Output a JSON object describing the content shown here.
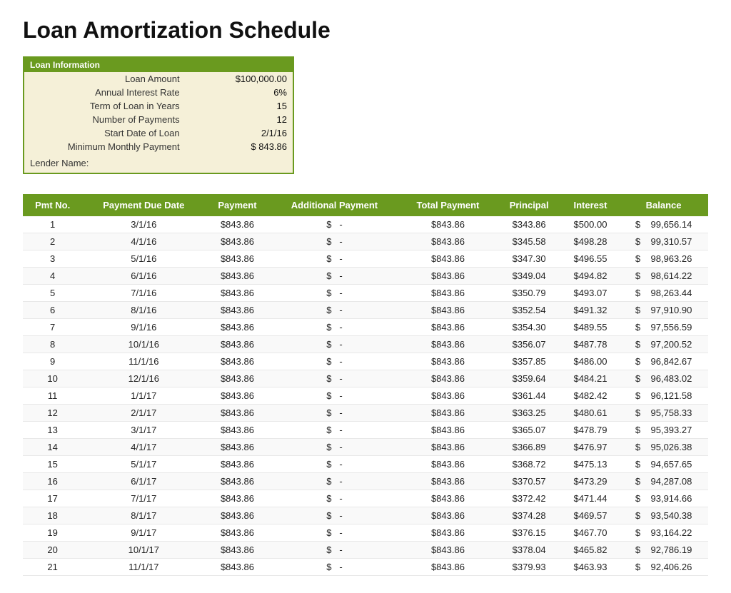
{
  "page": {
    "title": "Loan Amortization Schedule"
  },
  "loanInfo": {
    "sectionTitle": "Loan Information",
    "fields": [
      {
        "label": "Loan Amount",
        "value": "$100,000.00"
      },
      {
        "label": "Annual Interest Rate",
        "value": "6%"
      },
      {
        "label": "Term of Loan in Years",
        "value": "15"
      },
      {
        "label": "Number of Payments",
        "value": "12"
      },
      {
        "label": "Start Date of Loan",
        "value": "2/1/16"
      },
      {
        "label": "Minimum Monthly Payment",
        "value": "$     843.86"
      }
    ],
    "lenderLabel": "Lender Name:"
  },
  "table": {
    "columns": [
      "Pmt No.",
      "Payment Due Date",
      "Payment",
      "Additional Payment",
      "Total Payment",
      "Principal",
      "Interest",
      "Balance"
    ],
    "rows": [
      {
        "pmt": "1",
        "date": "3/1/16",
        "payment": "$843.86",
        "addl_dollar": "$",
        "addl": "-",
        "total": "$843.86",
        "principal": "$343.86",
        "interest": "$500.00",
        "bal_dollar": "$",
        "balance": "99,656.14"
      },
      {
        "pmt": "2",
        "date": "4/1/16",
        "payment": "$843.86",
        "addl_dollar": "$",
        "addl": "-",
        "total": "$843.86",
        "principal": "$345.58",
        "interest": "$498.28",
        "bal_dollar": "$",
        "balance": "99,310.57"
      },
      {
        "pmt": "3",
        "date": "5/1/16",
        "payment": "$843.86",
        "addl_dollar": "$",
        "addl": "-",
        "total": "$843.86",
        "principal": "$347.30",
        "interest": "$496.55",
        "bal_dollar": "$",
        "balance": "98,963.26"
      },
      {
        "pmt": "4",
        "date": "6/1/16",
        "payment": "$843.86",
        "addl_dollar": "$",
        "addl": "-",
        "total": "$843.86",
        "principal": "$349.04",
        "interest": "$494.82",
        "bal_dollar": "$",
        "balance": "98,614.22"
      },
      {
        "pmt": "5",
        "date": "7/1/16",
        "payment": "$843.86",
        "addl_dollar": "$",
        "addl": "-",
        "total": "$843.86",
        "principal": "$350.79",
        "interest": "$493.07",
        "bal_dollar": "$",
        "balance": "98,263.44"
      },
      {
        "pmt": "6",
        "date": "8/1/16",
        "payment": "$843.86",
        "addl_dollar": "$",
        "addl": "-",
        "total": "$843.86",
        "principal": "$352.54",
        "interest": "$491.32",
        "bal_dollar": "$",
        "balance": "97,910.90"
      },
      {
        "pmt": "7",
        "date": "9/1/16",
        "payment": "$843.86",
        "addl_dollar": "$",
        "addl": "-",
        "total": "$843.86",
        "principal": "$354.30",
        "interest": "$489.55",
        "bal_dollar": "$",
        "balance": "97,556.59"
      },
      {
        "pmt": "8",
        "date": "10/1/16",
        "payment": "$843.86",
        "addl_dollar": "$",
        "addl": "-",
        "total": "$843.86",
        "principal": "$356.07",
        "interest": "$487.78",
        "bal_dollar": "$",
        "balance": "97,200.52"
      },
      {
        "pmt": "9",
        "date": "11/1/16",
        "payment": "$843.86",
        "addl_dollar": "$",
        "addl": "-",
        "total": "$843.86",
        "principal": "$357.85",
        "interest": "$486.00",
        "bal_dollar": "$",
        "balance": "96,842.67"
      },
      {
        "pmt": "10",
        "date": "12/1/16",
        "payment": "$843.86",
        "addl_dollar": "$",
        "addl": "-",
        "total": "$843.86",
        "principal": "$359.64",
        "interest": "$484.21",
        "bal_dollar": "$",
        "balance": "96,483.02"
      },
      {
        "pmt": "11",
        "date": "1/1/17",
        "payment": "$843.86",
        "addl_dollar": "$",
        "addl": "-",
        "total": "$843.86",
        "principal": "$361.44",
        "interest": "$482.42",
        "bal_dollar": "$",
        "balance": "96,121.58"
      },
      {
        "pmt": "12",
        "date": "2/1/17",
        "payment": "$843.86",
        "addl_dollar": "$",
        "addl": "-",
        "total": "$843.86",
        "principal": "$363.25",
        "interest": "$480.61",
        "bal_dollar": "$",
        "balance": "95,758.33"
      },
      {
        "pmt": "13",
        "date": "3/1/17",
        "payment": "$843.86",
        "addl_dollar": "$",
        "addl": "-",
        "total": "$843.86",
        "principal": "$365.07",
        "interest": "$478.79",
        "bal_dollar": "$",
        "balance": "95,393.27"
      },
      {
        "pmt": "14",
        "date": "4/1/17",
        "payment": "$843.86",
        "addl_dollar": "$",
        "addl": "-",
        "total": "$843.86",
        "principal": "$366.89",
        "interest": "$476.97",
        "bal_dollar": "$",
        "balance": "95,026.38"
      },
      {
        "pmt": "15",
        "date": "5/1/17",
        "payment": "$843.86",
        "addl_dollar": "$",
        "addl": "-",
        "total": "$843.86",
        "principal": "$368.72",
        "interest": "$475.13",
        "bal_dollar": "$",
        "balance": "94,657.65"
      },
      {
        "pmt": "16",
        "date": "6/1/17",
        "payment": "$843.86",
        "addl_dollar": "$",
        "addl": "-",
        "total": "$843.86",
        "principal": "$370.57",
        "interest": "$473.29",
        "bal_dollar": "$",
        "balance": "94,287.08"
      },
      {
        "pmt": "17",
        "date": "7/1/17",
        "payment": "$843.86",
        "addl_dollar": "$",
        "addl": "-",
        "total": "$843.86",
        "principal": "$372.42",
        "interest": "$471.44",
        "bal_dollar": "$",
        "balance": "93,914.66"
      },
      {
        "pmt": "18",
        "date": "8/1/17",
        "payment": "$843.86",
        "addl_dollar": "$",
        "addl": "-",
        "total": "$843.86",
        "principal": "$374.28",
        "interest": "$469.57",
        "bal_dollar": "$",
        "balance": "93,540.38"
      },
      {
        "pmt": "19",
        "date": "9/1/17",
        "payment": "$843.86",
        "addl_dollar": "$",
        "addl": "-",
        "total": "$843.86",
        "principal": "$376.15",
        "interest": "$467.70",
        "bal_dollar": "$",
        "balance": "93,164.22"
      },
      {
        "pmt": "20",
        "date": "10/1/17",
        "payment": "$843.86",
        "addl_dollar": "$",
        "addl": "-",
        "total": "$843.86",
        "principal": "$378.04",
        "interest": "$465.82",
        "bal_dollar": "$",
        "balance": "92,786.19"
      },
      {
        "pmt": "21",
        "date": "11/1/17",
        "payment": "$843.86",
        "addl_dollar": "$",
        "addl": "-",
        "total": "$843.86",
        "principal": "$379.93",
        "interest": "$463.93",
        "bal_dollar": "$",
        "balance": "92,406.26"
      }
    ]
  }
}
